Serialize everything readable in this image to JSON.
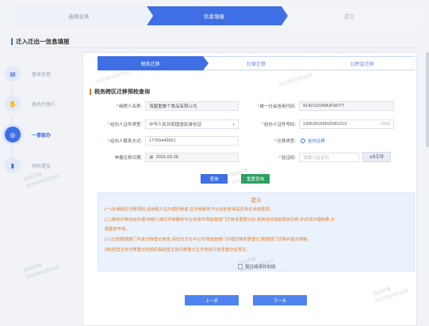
{
  "top_steps": [
    {
      "label": "选择业务",
      "state": "done"
    },
    {
      "label": "信息填报",
      "state": "active"
    },
    {
      "label": "提交",
      "state": "todo"
    }
  ],
  "page_title": "迁入迁出一信息填报",
  "left_nav": [
    {
      "label": "基本信息",
      "icon": "info-icon",
      "active": false
    },
    {
      "label": "委托代理人",
      "icon": "handshake-icon",
      "active": false
    },
    {
      "label": "一事联办",
      "icon": "link-icon",
      "active": true
    },
    {
      "label": "材料提交",
      "icon": "document-icon",
      "active": false
    }
  ],
  "sub_steps": [
    {
      "label": "税务迁移",
      "active": true
    },
    {
      "label": "社保迁移",
      "active": false
    },
    {
      "label": "公积金迁移",
      "active": false
    }
  ],
  "section_title": "税务跨区迁移预检查询",
  "form": {
    "taxpayer_name_label": "纳税人名称:",
    "taxpayer_name_value": "海盟重餐个食品有限公司",
    "credit_code_label": "统一社会信用代码:",
    "credit_code_value": "91421102MA3FMJ7T",
    "id_type_label": "经办人证件类型:",
    "id_type_value": "中华人民共和国居民身份证",
    "id_no_label": "经办人证件号码:",
    "id_no_value": "130628199502081313",
    "id_no_count": "18/30",
    "phone_label": "经办人联系方式:",
    "phone_value": "17765440001",
    "move_type_label": "迁移类型:",
    "move_type_value": "省内迁移",
    "move_date_label": "申报迁移日期:",
    "move_date_value": "2025-03-28",
    "captcha_label": "验证码:",
    "captcha_placeholder": "请输入验证码",
    "captcha_code": "xbU9"
  },
  "buttons": {
    "query": "查询",
    "reset": "重置查询",
    "prev": "上一步",
    "next": "下一步"
  },
  "tips": {
    "title": "提示",
    "lines": [
      "(一)社保跨区迁移预检,请纳税人在办理迁移前,在迁移服务平台自检查询是否存在未结事项。",
      "(二)税务迁移自动办理:纳税人通过迁移服务平台完成市场监管部门迁移变更登记后,系统自动发起税务迁移,并反馈办理结果,无",
      "需重复申请。",
      "(三)已经根据部门共享迁移登记信息,请迁出方在平台市场监管部门办理迁移变更登记,根据部门迁移并提交转移。",
      "(四)经营主体迁移登记完成后需经营主体迁移登记主办地进行信息登记后发生。"
    ],
    "check_label": "我已阅读并知晓"
  },
  "watermark": {
    "line1": "测试环境",
    "line2": "2025年03月28日"
  }
}
